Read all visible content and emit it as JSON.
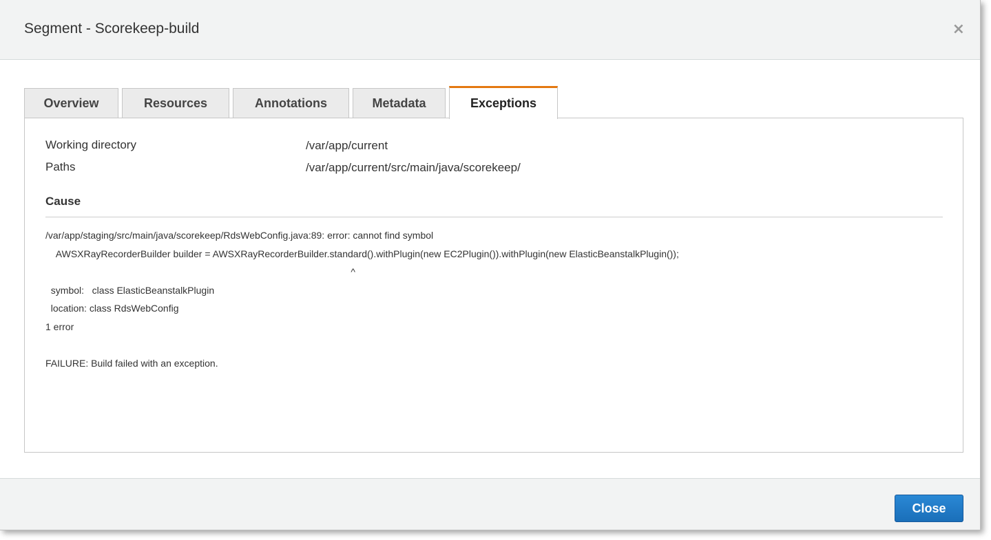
{
  "dialog": {
    "title": "Segment - Scorekeep-build",
    "close_icon_glyph": "×"
  },
  "tabs": [
    {
      "label": "Overview",
      "active": false
    },
    {
      "label": "Resources",
      "active": false
    },
    {
      "label": "Annotations",
      "active": false
    },
    {
      "label": "Metadata",
      "active": false
    },
    {
      "label": "Exceptions",
      "active": true
    }
  ],
  "exceptions": {
    "working_directory_label": "Working directory",
    "working_directory_value": "/var/app/current",
    "paths_label": "Paths",
    "paths_value": "/var/app/current/src/main/java/scorekeep/",
    "cause_heading": "Cause",
    "cause_text": "/var/app/staging/src/main/java/scorekeep/RdsWebConfig.java:89: error: cannot find symbol\n    AWSXRayRecorderBuilder builder = AWSXRayRecorderBuilder.standard().withPlugin(new EC2Plugin()).withPlugin(new ElasticBeanstalkPlugin());\n                                                                                                                  ^\n  symbol:   class ElasticBeanstalkPlugin\n  location: class RdsWebConfig\n1 error\n\nFAILURE: Build failed with an exception."
  },
  "footer": {
    "close_label": "Close"
  },
  "colors": {
    "active_tab_accent": "#e47911",
    "primary_button": "#1a6fb9",
    "header_background": "#f2f3f3"
  }
}
